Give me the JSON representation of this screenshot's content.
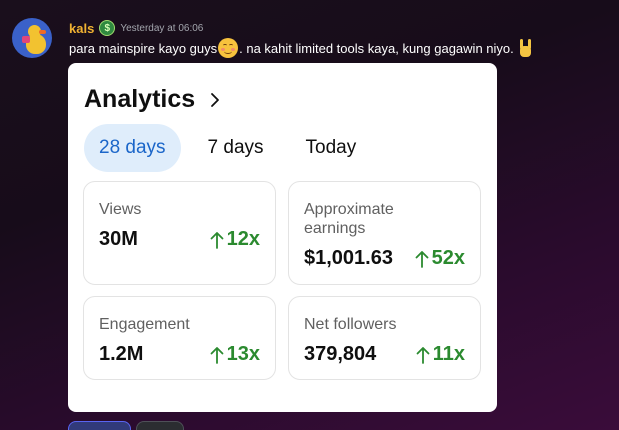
{
  "message": {
    "username": "kals",
    "badge": "$",
    "timestamp": "Yesterday at 06:06",
    "text_part1": "para mainspire kayo guys",
    "text_part2": ". na kahit limited tools kaya, kung gagawin niyo.",
    "emoji_1": "smiling-face-icon",
    "emoji_2": "rock-on-hand-icon"
  },
  "card": {
    "title": "Analytics",
    "tabs": [
      {
        "label": "28 days",
        "active": true
      },
      {
        "label": "7 days",
        "active": false
      },
      {
        "label": "Today",
        "active": false
      }
    ],
    "metrics": [
      {
        "label_line1": "Views",
        "label_line2": "",
        "value": "30M",
        "growth": "12x"
      },
      {
        "label_line1": "Approximate",
        "label_line2": "earnings",
        "value": "$1,001.63",
        "growth": "52x"
      },
      {
        "label_line1": "Engagement",
        "label_line2": "",
        "value": "1.2M",
        "growth": "13x"
      },
      {
        "label_line1": "Net followers",
        "label_line2": "",
        "value": "379,804",
        "growth": "11x"
      }
    ]
  },
  "colors": {
    "username": "#f0b232",
    "active_tab_bg": "#dfedfb",
    "active_tab_text": "#1b66c9",
    "growth": "#2b8a2f"
  }
}
